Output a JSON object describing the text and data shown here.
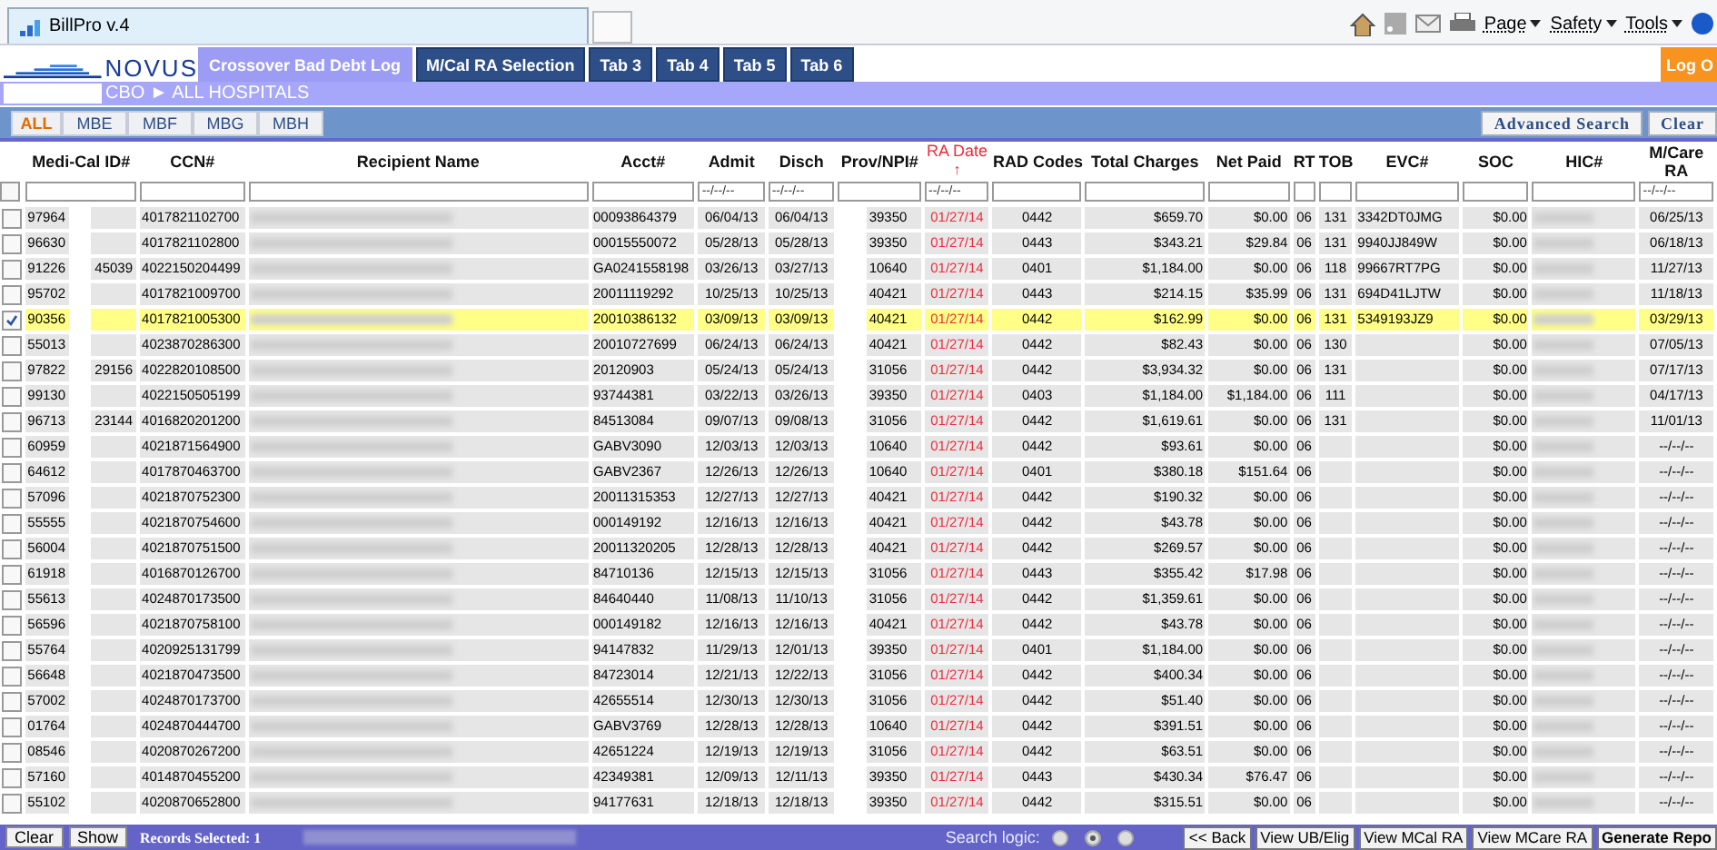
{
  "browser": {
    "tab_title": "BillPro v.4",
    "menus": [
      {
        "label": "Page"
      },
      {
        "label": "Safety"
      },
      {
        "label": "Tools"
      }
    ]
  },
  "app": {
    "logo": "NOVUS",
    "logout": "Log O",
    "breadcrumb": "CBO ► ALL HOSPITALS",
    "tabs": [
      {
        "label": "Crossover Bad Debt Log",
        "selected": true
      },
      {
        "label": "M/Cal RA Selection",
        "selected": false
      },
      {
        "label": "Tab 3",
        "selected": false
      },
      {
        "label": "Tab 4",
        "selected": false
      },
      {
        "label": "Tab 5",
        "selected": false
      },
      {
        "label": "Tab 6",
        "selected": false
      }
    ],
    "subtabs": [
      {
        "label": "ALL",
        "selected": true
      },
      {
        "label": "MBE",
        "selected": false
      },
      {
        "label": "MBF",
        "selected": false
      },
      {
        "label": "MBG",
        "selected": false
      },
      {
        "label": "MBH",
        "selected": false
      }
    ],
    "actions": [
      "Advanced Search",
      "Clear"
    ]
  },
  "table": {
    "select_all": {
      "checked": false
    },
    "columns": [
      {
        "label": "Medi-Cal ID#",
        "kind": "masked-id"
      },
      {
        "label": "CCN#",
        "kind": "text"
      },
      {
        "label": "Recipient Name",
        "kind": "redacted"
      },
      {
        "label": "Acct#",
        "kind": "text"
      },
      {
        "label": "Admit",
        "placeholder": "--/--/--",
        "kind": "center"
      },
      {
        "label": "Disch",
        "placeholder": "--/--/--",
        "kind": "center"
      },
      {
        "label": "Prov/NPI#",
        "kind": "masked-prov"
      },
      {
        "label": "RA Date",
        "placeholder": "--/--/--",
        "sort_arrow": "↑",
        "kind": "center"
      },
      {
        "label": "RAD Codes",
        "kind": "center"
      },
      {
        "label": "Total Charges",
        "kind": "right"
      },
      {
        "label": "Net Paid",
        "kind": "right"
      },
      {
        "label": "RT",
        "kind": "center"
      },
      {
        "label": "TOB",
        "kind": "center"
      },
      {
        "label": "EVC#",
        "kind": "text"
      },
      {
        "label": "SOC",
        "kind": "right"
      },
      {
        "label": "HIC#",
        "kind": "redacted"
      },
      {
        "label": "M/Care RA",
        "placeholder": "--/--/--",
        "kind": "center"
      }
    ],
    "rows": [
      {
        "checked": false,
        "medi": "97964",
        "ccn": "4017821102700",
        "acct": "00093864379",
        "admit": "06/04/13",
        "disch": "06/04/13",
        "prov": "39350",
        "ra": "01/27/14",
        "rad": "0442",
        "total": "$659.70",
        "net": "$0.00",
        "rt": "06",
        "tob": "131",
        "evc": "3342DT0JMG",
        "soc": "$0.00",
        "mcare": "06/25/13"
      },
      {
        "checked": false,
        "medi": "96630",
        "ccn": "4017821102800",
        "acct": "00015550072",
        "admit": "05/28/13",
        "disch": "05/28/13",
        "prov": "39350",
        "ra": "01/27/14",
        "rad": "0443",
        "total": "$343.21",
        "net": "$29.84",
        "rt": "06",
        "tob": "131",
        "evc": "9940JJ849W",
        "soc": "$0.00",
        "mcare": "06/18/13"
      },
      {
        "checked": false,
        "medi": "91226",
        "medi_tail": "45039",
        "ccn": "4022150204499",
        "acct": "GA0241558198",
        "admit": "03/26/13",
        "disch": "03/27/13",
        "prov": "10640",
        "ra": "01/27/14",
        "rad": "0401",
        "total": "$1,184.00",
        "net": "$0.00",
        "rt": "06",
        "tob": "118",
        "evc": "99667RT7PG",
        "soc": "$0.00",
        "mcare": "11/27/13"
      },
      {
        "checked": false,
        "medi": "95702",
        "ccn": "4017821009700",
        "acct": "20011119292",
        "admit": "10/25/13",
        "disch": "10/25/13",
        "prov": "40421",
        "ra": "01/27/14",
        "rad": "0443",
        "total": "$214.15",
        "net": "$35.99",
        "rt": "06",
        "tob": "131",
        "evc": "694D41LJTW",
        "soc": "$0.00",
        "mcare": "11/18/13"
      },
      {
        "checked": true,
        "medi": "90356",
        "ccn": "4017821005300",
        "acct": "20010386132",
        "admit": "03/09/13",
        "disch": "03/09/13",
        "prov": "40421",
        "ra": "01/27/14",
        "rad": "0442",
        "total": "$162.99",
        "net": "$0.00",
        "rt": "06",
        "tob": "131",
        "evc": "5349193JZ9",
        "soc": "$0.00",
        "mcare": "03/29/13"
      },
      {
        "checked": false,
        "medi": "55013",
        "ccn": "4023870286300",
        "acct": "20010727699",
        "admit": "06/24/13",
        "disch": "06/24/13",
        "prov": "40421",
        "ra": "01/27/14",
        "rad": "0442",
        "total": "$82.43",
        "net": "$0.00",
        "rt": "06",
        "tob": "130",
        "soc": "$0.00",
        "mcare": "07/05/13"
      },
      {
        "checked": false,
        "medi": "97822",
        "medi_tail": "29156",
        "ccn": "4022820108500",
        "acct": "20120903",
        "admit": "05/24/13",
        "disch": "05/24/13",
        "prov": "31056",
        "ra": "01/27/14",
        "rad": "0442",
        "total": "$3,934.32",
        "net": "$0.00",
        "rt": "06",
        "tob": "131",
        "soc": "$0.00",
        "mcare": "07/17/13"
      },
      {
        "checked": false,
        "medi": "99130",
        "ccn": "4022150505199",
        "acct": "93744381",
        "admit": "03/22/13",
        "disch": "03/26/13",
        "prov": "39350",
        "ra": "01/27/14",
        "rad": "0403",
        "total": "$1,184.00",
        "net": "$1,184.00",
        "rt": "06",
        "tob": "111",
        "soc": "$0.00",
        "mcare": "04/17/13"
      },
      {
        "checked": false,
        "medi": "96713",
        "medi_tail": "23144",
        "ccn": "4016820201200",
        "acct": "84513084",
        "admit": "09/07/13",
        "disch": "09/08/13",
        "prov": "31056",
        "ra": "01/27/14",
        "rad": "0442",
        "total": "$1,619.61",
        "net": "$0.00",
        "rt": "06",
        "tob": "131",
        "soc": "$0.00",
        "mcare": "11/01/13"
      },
      {
        "checked": false,
        "medi": "60959",
        "ccn": "4021871564900",
        "acct": "GABV3090",
        "admit": "12/03/13",
        "disch": "12/03/13",
        "prov": "10640",
        "ra": "01/27/14",
        "rad": "0442",
        "total": "$93.61",
        "net": "$0.00",
        "rt": "06",
        "soc": "$0.00",
        "mcare": "--/--/--"
      },
      {
        "checked": false,
        "medi": "64612",
        "ccn": "4017870463700",
        "acct": "GABV2367",
        "admit": "12/26/13",
        "disch": "12/26/13",
        "prov": "10640",
        "ra": "01/27/14",
        "rad": "0401",
        "total": "$380.18",
        "net": "$151.64",
        "rt": "06",
        "soc": "$0.00",
        "mcare": "--/--/--"
      },
      {
        "checked": false,
        "medi": "57096",
        "ccn": "4021870752300",
        "acct": "20011315353",
        "admit": "12/27/13",
        "disch": "12/27/13",
        "prov": "40421",
        "ra": "01/27/14",
        "rad": "0442",
        "total": "$190.32",
        "net": "$0.00",
        "rt": "06",
        "soc": "$0.00",
        "mcare": "--/--/--"
      },
      {
        "checked": false,
        "medi": "55555",
        "ccn": "4021870754600",
        "acct": "000149192",
        "admit": "12/16/13",
        "disch": "12/16/13",
        "prov": "40421",
        "ra": "01/27/14",
        "rad": "0442",
        "total": "$43.78",
        "net": "$0.00",
        "rt": "06",
        "soc": "$0.00",
        "mcare": "--/--/--"
      },
      {
        "checked": false,
        "medi": "56004",
        "ccn": "4021870751500",
        "acct": "20011320205",
        "admit": "12/28/13",
        "disch": "12/28/13",
        "prov": "40421",
        "ra": "01/27/14",
        "rad": "0442",
        "total": "$269.57",
        "net": "$0.00",
        "rt": "06",
        "soc": "$0.00",
        "mcare": "--/--/--"
      },
      {
        "checked": false,
        "medi": "61918",
        "ccn": "4016870126700",
        "acct": "84710136",
        "admit": "12/15/13",
        "disch": "12/15/13",
        "prov": "31056",
        "ra": "01/27/14",
        "rad": "0443",
        "total": "$355.42",
        "net": "$17.98",
        "rt": "06",
        "soc": "$0.00",
        "mcare": "--/--/--"
      },
      {
        "checked": false,
        "medi": "55613",
        "ccn": "4024870173500",
        "acct": "84640440",
        "admit": "11/08/13",
        "disch": "11/10/13",
        "prov": "31056",
        "ra": "01/27/14",
        "rad": "0442",
        "total": "$1,359.61",
        "net": "$0.00",
        "rt": "06",
        "soc": "$0.00",
        "mcare": "--/--/--"
      },
      {
        "checked": false,
        "medi": "56596",
        "ccn": "4021870758100",
        "acct": "000149182",
        "admit": "12/16/13",
        "disch": "12/16/13",
        "prov": "40421",
        "ra": "01/27/14",
        "rad": "0442",
        "total": "$43.78",
        "net": "$0.00",
        "rt": "06",
        "soc": "$0.00",
        "mcare": "--/--/--"
      },
      {
        "checked": false,
        "medi": "55764",
        "ccn": "4020925131799",
        "acct": "94147832",
        "admit": "11/29/13",
        "disch": "12/01/13",
        "prov": "39350",
        "ra": "01/27/14",
        "rad": "0401",
        "total": "$1,184.00",
        "net": "$0.00",
        "rt": "06",
        "soc": "$0.00",
        "mcare": "--/--/--"
      },
      {
        "checked": false,
        "medi": "56648",
        "ccn": "4021870473500",
        "acct": "84723014",
        "admit": "12/21/13",
        "disch": "12/22/13",
        "prov": "31056",
        "ra": "01/27/14",
        "rad": "0442",
        "total": "$400.34",
        "net": "$0.00",
        "rt": "06",
        "soc": "$0.00",
        "mcare": "--/--/--"
      },
      {
        "checked": false,
        "medi": "57002",
        "ccn": "4024870173700",
        "acct": "42655514",
        "admit": "12/30/13",
        "disch": "12/30/13",
        "prov": "31056",
        "ra": "01/27/14",
        "rad": "0442",
        "total": "$51.40",
        "net": "$0.00",
        "rt": "06",
        "soc": "$0.00",
        "mcare": "--/--/--"
      },
      {
        "checked": false,
        "medi": "01764",
        "ccn": "4024870444700",
        "acct": "GABV3769",
        "admit": "12/28/13",
        "disch": "12/28/13",
        "prov": "10640",
        "ra": "01/27/14",
        "rad": "0442",
        "total": "$391.51",
        "net": "$0.00",
        "rt": "06",
        "soc": "$0.00",
        "mcare": "--/--/--"
      },
      {
        "checked": false,
        "medi": "08546",
        "ccn": "4020870267200",
        "acct": "42651224",
        "admit": "12/19/13",
        "disch": "12/19/13",
        "prov": "31056",
        "ra": "01/27/14",
        "rad": "0442",
        "total": "$63.51",
        "net": "$0.00",
        "rt": "06",
        "soc": "$0.00",
        "mcare": "--/--/--"
      },
      {
        "checked": false,
        "medi": "57160",
        "ccn": "4014870455200",
        "acct": "42349381",
        "admit": "12/09/13",
        "disch": "12/11/13",
        "prov": "39350",
        "ra": "01/27/14",
        "rad": "0443",
        "total": "$430.34",
        "net": "$76.47",
        "rt": "06",
        "soc": "$0.00",
        "mcare": "--/--/--"
      },
      {
        "checked": false,
        "medi": "55102",
        "ccn": "4020870652800",
        "acct": "94177631",
        "admit": "12/18/13",
        "disch": "12/18/13",
        "prov": "39350",
        "ra": "01/27/14",
        "rad": "0442",
        "total": "$315.51",
        "net": "$0.00",
        "rt": "06",
        "soc": "$0.00",
        "mcare": "--/--/--"
      }
    ]
  },
  "footer": {
    "buttons": [
      "Clear",
      "Show"
    ],
    "records": "Records Selected: 1",
    "search_logic": "Search logic:",
    "radios": [
      {
        "selected": false
      },
      {
        "selected": true
      },
      {
        "selected": false
      }
    ],
    "actions": [
      "<< Back",
      "View UB/Elig",
      "View MCal RA",
      "View MCare RA",
      "Generate Repo"
    ]
  }
}
